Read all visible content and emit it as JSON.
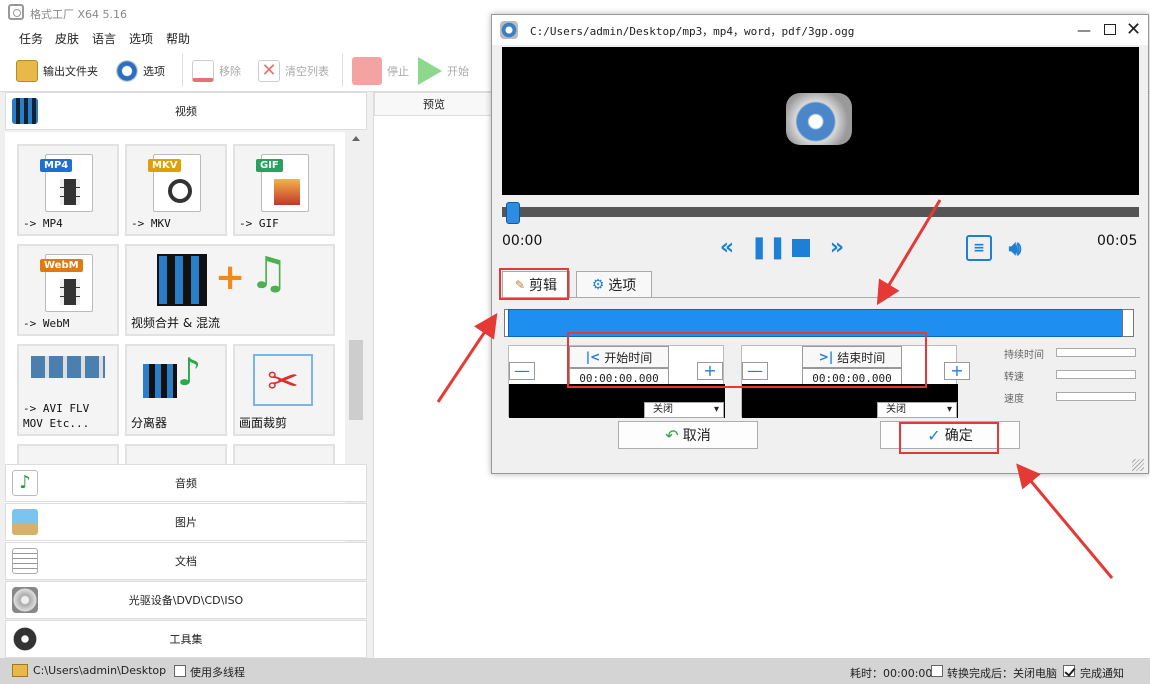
{
  "window": {
    "title": "格式工厂 X64 5.16"
  },
  "menu": [
    "任务",
    "皮肤",
    "语言",
    "选项",
    "帮助"
  ],
  "toolbar": {
    "output_folder": "输出文件夹",
    "options": "选项",
    "remove": "移除",
    "clear_list": "清空列表",
    "stop": "停止",
    "start": "开始"
  },
  "categories": {
    "video": "视频",
    "audio": "音频",
    "image": "图片",
    "document": "文档",
    "disc": "光驱设备\\DVD\\CD\\ISO",
    "tools": "工具集"
  },
  "tiles": [
    {
      "label": "-> MP4",
      "tag": "MP4",
      "tag_color": "#1f6fd0"
    },
    {
      "label": "-> MKV",
      "tag": "MKV",
      "tag_color": "#e0a000"
    },
    {
      "label": "-> GIF",
      "tag": "GIF",
      "tag_color": "#27a060"
    },
    {
      "label": "-> WebM",
      "tag": "WebM",
      "tag_color": "#e07a10"
    },
    {
      "label": "视频合并 & 混流"
    },
    {
      "label": "-> AVI FLV\nMOV Etc..."
    },
    {
      "label": "分离器"
    },
    {
      "label": "画面裁剪"
    }
  ],
  "preview": {
    "header": "预览"
  },
  "status": {
    "path": "C:\\Users\\admin\\Desktop",
    "multithread": "使用多线程",
    "elapsed": "耗时：00:00:00",
    "after_convert": "转换完成后：关闭电脑",
    "notify": "完成通知"
  },
  "dialog": {
    "title": "C:/Users/admin/Desktop/mp3，mp4，word，pdf/3gp.ogg",
    "time_start": "00:00",
    "time_end": "00:05",
    "tab_cut": "剪辑",
    "tab_options": "选项",
    "start_time_label": "开始时间",
    "end_time_label": "结束时间",
    "start_time_value": "00:00:00.000",
    "end_time_value": "00:00:00.000",
    "select_off": "关闭",
    "right_labels": [
      "持续时间",
      "转速",
      "速度"
    ],
    "cancel": "取消",
    "ok": "确定"
  },
  "colors": {
    "accent": "#1e7fd6",
    "highlight": "#e53935",
    "bar": "#1e8ff0"
  }
}
